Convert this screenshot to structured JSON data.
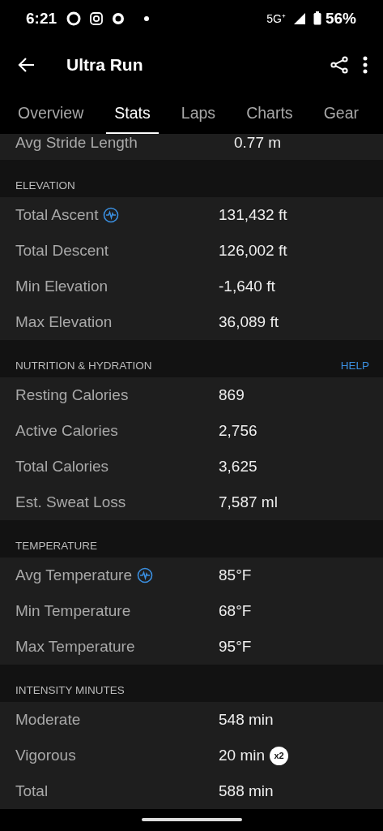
{
  "status_bar": {
    "time": "6:21",
    "network": "5G⁺",
    "battery": "56%"
  },
  "app_bar": {
    "title": "Ultra Run"
  },
  "tabs": [
    {
      "label": "Overview",
      "selected": false
    },
    {
      "label": "Stats",
      "selected": true
    },
    {
      "label": "Laps",
      "selected": false
    },
    {
      "label": "Charts",
      "selected": false
    },
    {
      "label": "Gear",
      "selected": false
    }
  ],
  "partial_row": {
    "label": "Avg Stride Length",
    "value": "0.77 m"
  },
  "sections": [
    {
      "title": "ELEVATION",
      "rows": [
        {
          "label": "Total Ascent",
          "value": "131,432 ft",
          "chart_link": true
        },
        {
          "label": "Total Descent",
          "value": "126,002 ft",
          "chart_link": false
        },
        {
          "label": "Min Elevation",
          "value": "-1,640 ft",
          "chart_link": false
        },
        {
          "label": "Max Elevation",
          "value": "36,089 ft",
          "chart_link": false
        }
      ]
    },
    {
      "title": "NUTRITION & HYDRATION",
      "action": "HELP",
      "rows": [
        {
          "label": "Resting Calories",
          "value": "869",
          "chart_link": false
        },
        {
          "label": "Active Calories",
          "value": "2,756",
          "chart_link": false
        },
        {
          "label": "Total Calories",
          "value": "3,625",
          "chart_link": false
        },
        {
          "label": "Est. Sweat Loss",
          "value": "7,587 ml",
          "chart_link": false
        }
      ]
    },
    {
      "title": "TEMPERATURE",
      "rows": [
        {
          "label": "Avg Temperature",
          "value": "85°F",
          "chart_link": true
        },
        {
          "label": "Min Temperature",
          "value": "68°F",
          "chart_link": false
        },
        {
          "label": "Max Temperature",
          "value": "95°F",
          "chart_link": false
        }
      ]
    },
    {
      "title": "INTENSITY MINUTES",
      "rows": [
        {
          "label": "Moderate",
          "value": "548 min",
          "chart_link": false
        },
        {
          "label": "Vigorous",
          "value": "20 min",
          "badge": "x2",
          "chart_link": false
        },
        {
          "label": "Total",
          "value": "588 min",
          "chart_link": false
        }
      ]
    }
  ]
}
